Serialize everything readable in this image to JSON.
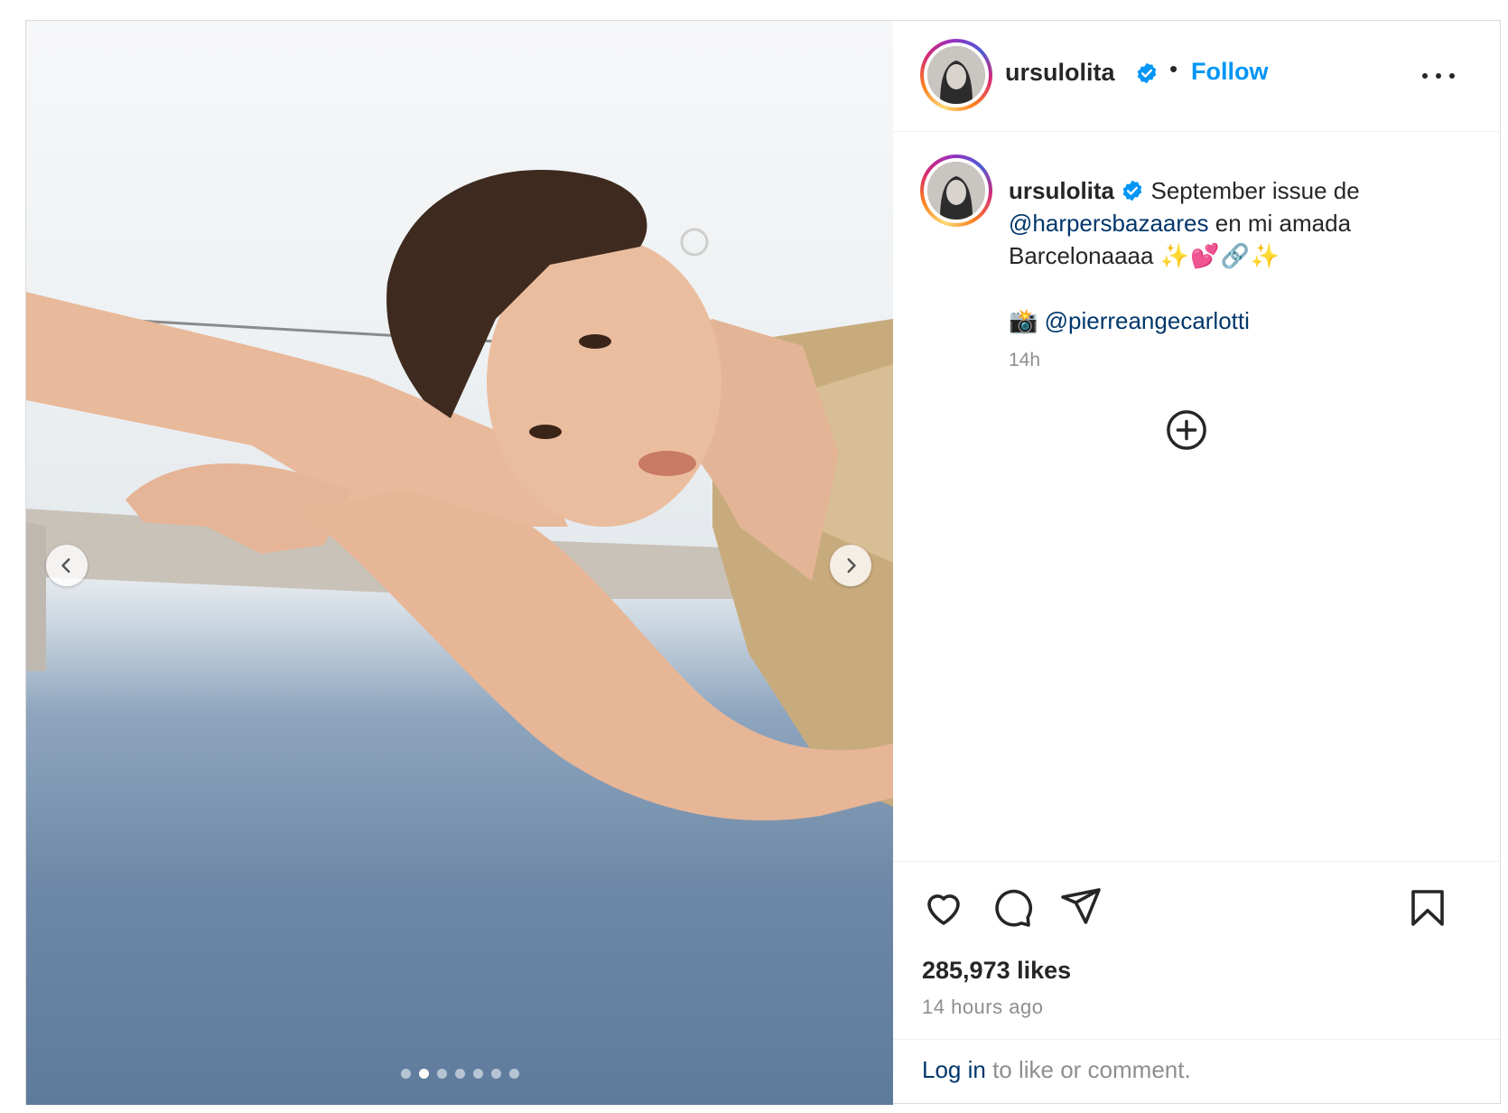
{
  "post": {
    "username": "ursulolita",
    "follow_label": "Follow",
    "separator": "•",
    "caption": {
      "line1": "September issue de",
      "mention1": "@harpersbazaares",
      "line2_rest": " en mi amada",
      "line3": "Barcelonaaaa",
      "line3_emoji": "✨💕🔗✨",
      "camera_emoji": "📸",
      "mention2": "@pierreangecarlotti"
    },
    "time_short": "14h",
    "likes": "285,973 likes",
    "time_long": "14 hours ago",
    "login_link": "Log in",
    "login_rest": " to like or comment.",
    "carousel": {
      "slide_count": 7,
      "active_index": 1
    }
  },
  "colors": {
    "accent": "#0095f6",
    "mention": "#00376b",
    "muted": "#8e8e8e",
    "verified": "#0095f6"
  },
  "icons": [
    "chevron-left-icon",
    "chevron-right-icon",
    "verified-icon",
    "more-icon",
    "add-circle-icon",
    "heart-icon",
    "comment-icon",
    "share-icon",
    "bookmark-icon"
  ]
}
